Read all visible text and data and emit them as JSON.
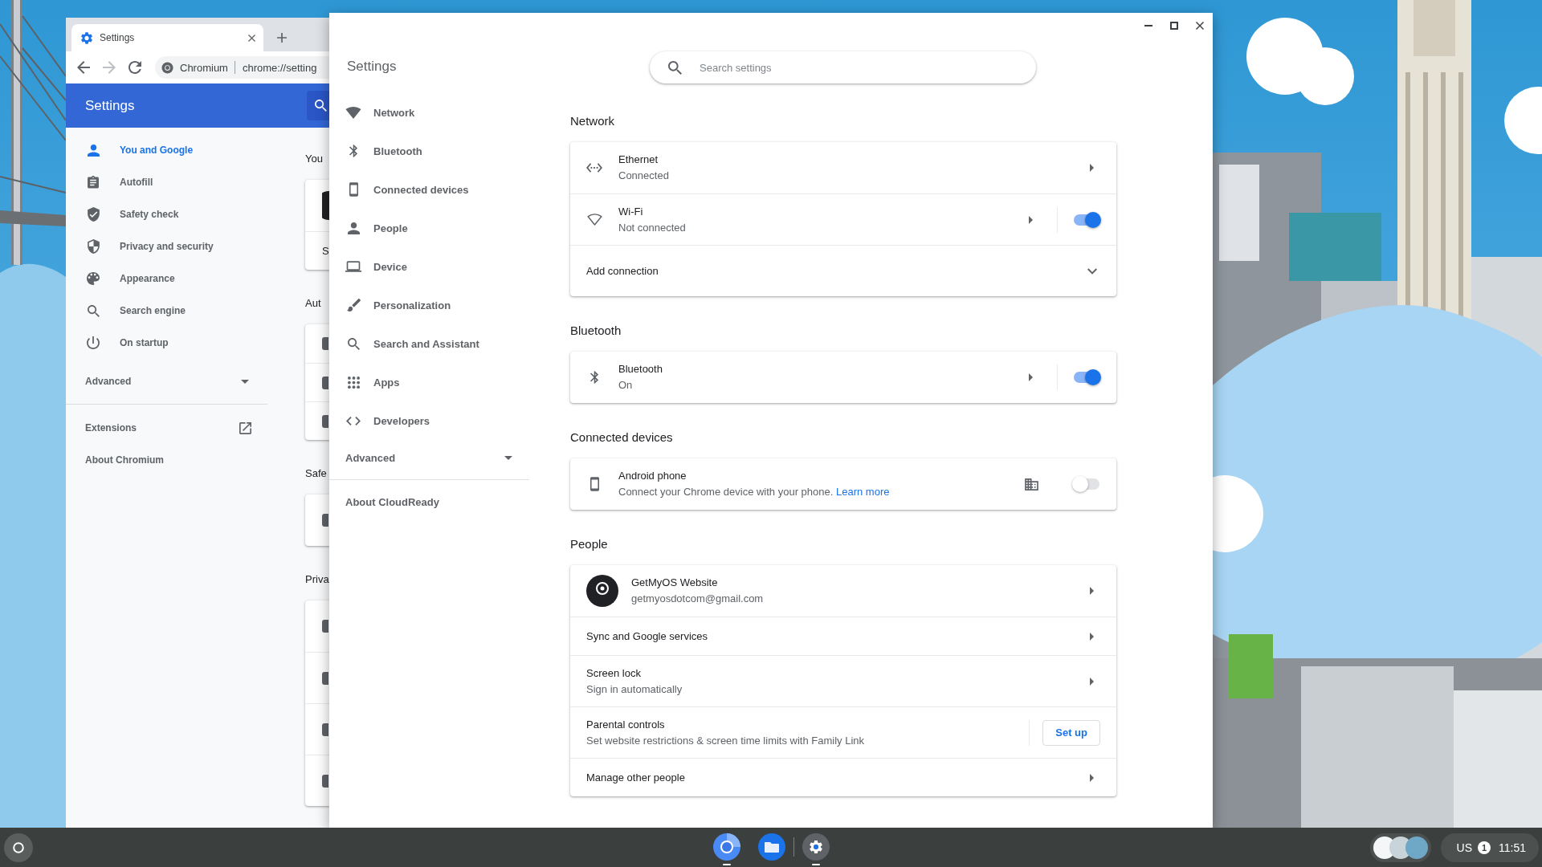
{
  "browser_window": {
    "tabs": [
      {
        "title": "Settings",
        "selected": true
      }
    ],
    "toolbar": {
      "buttons": [
        {
          "disabled": false
        },
        {
          "disabled": true
        },
        {
          "disabled": false
        }
      ],
      "site_name": "Chromium",
      "url": "chrome://setting"
    },
    "header": {
      "title": "Settings"
    },
    "sidebar": {
      "items": [
        {
          "label": "You and Google",
          "selected": true
        },
        {
          "label": "Autofill",
          "selected": false
        },
        {
          "label": "Safety check",
          "selected": false
        },
        {
          "label": "Privacy and security",
          "selected": false
        },
        {
          "label": "Appearance",
          "selected": false
        },
        {
          "label": "Search engine",
          "selected": false
        },
        {
          "label": "On startup",
          "selected": false
        }
      ],
      "advanced": {
        "label": "Advanced",
        "expanded": false
      },
      "links": [
        {
          "label": "Extensions",
          "kind": "external"
        },
        {
          "label": "About Chromium",
          "kind": "plain"
        }
      ]
    },
    "page": {
      "sections": [
        {
          "title": "You",
          "row_text": "S"
        },
        {
          "title": "Aut"
        },
        {
          "title": "Safe"
        },
        {
          "title": "Priva"
        }
      ]
    }
  },
  "settings_window": {
    "title": "Settings",
    "search": {
      "placeholder": "Search settings"
    },
    "nav": [
      {
        "label": "Network",
        "selected": false
      },
      {
        "label": "Bluetooth",
        "selected": false
      },
      {
        "label": "Connected devices",
        "selected": false
      },
      {
        "label": "People",
        "selected": false
      },
      {
        "label": "Device",
        "selected": false
      },
      {
        "label": "Personalization",
        "selected": false
      },
      {
        "label": "Search and Assistant",
        "selected": false
      },
      {
        "label": "Apps",
        "selected": false
      },
      {
        "label": "Developers",
        "selected": false
      }
    ],
    "advanced": {
      "label": "Advanced",
      "expanded": false
    },
    "about": "About CloudReady",
    "sections": [
      {
        "title": "Network",
        "rows": [
          {
            "kind": "link",
            "title": "Ethernet",
            "subtitle": "Connected"
          },
          {
            "kind": "link_toggle",
            "title": "Wi-Fi",
            "subtitle": "Not connected",
            "on": true
          },
          {
            "kind": "expand",
            "title": "Add connection",
            "expanded": false
          }
        ]
      },
      {
        "title": "Bluetooth",
        "rows": [
          {
            "kind": "link_toggle",
            "title": "Bluetooth",
            "subtitle": "On",
            "on": true
          }
        ]
      },
      {
        "title": "Connected devices",
        "rows": [
          {
            "kind": "toggle",
            "title": "Android phone",
            "subtitle": "Connect your Chrome device with your phone.",
            "link": "Learn more",
            "managed": true,
            "on": false
          }
        ]
      },
      {
        "title": "People",
        "rows": [
          {
            "kind": "account",
            "title": "GetMyOS Website",
            "subtitle": "getmyosdotcom@gmail.com"
          },
          {
            "kind": "link",
            "title": "Sync and Google services"
          },
          {
            "kind": "link",
            "title": "Screen lock",
            "subtitle": "Sign in automatically"
          },
          {
            "kind": "button",
            "title": "Parental controls",
            "subtitle": "Set website restrictions & screen time limits with Family Link",
            "button": "Set up"
          },
          {
            "kind": "link",
            "title": "Manage other people"
          }
        ]
      }
    ]
  },
  "shelf": {
    "apps": [
      {
        "running": true
      },
      {
        "running": false
      },
      {
        "running": true
      }
    ],
    "status": {
      "keyboard_layout": "US",
      "notification_count": "1",
      "time": "11:51"
    }
  }
}
